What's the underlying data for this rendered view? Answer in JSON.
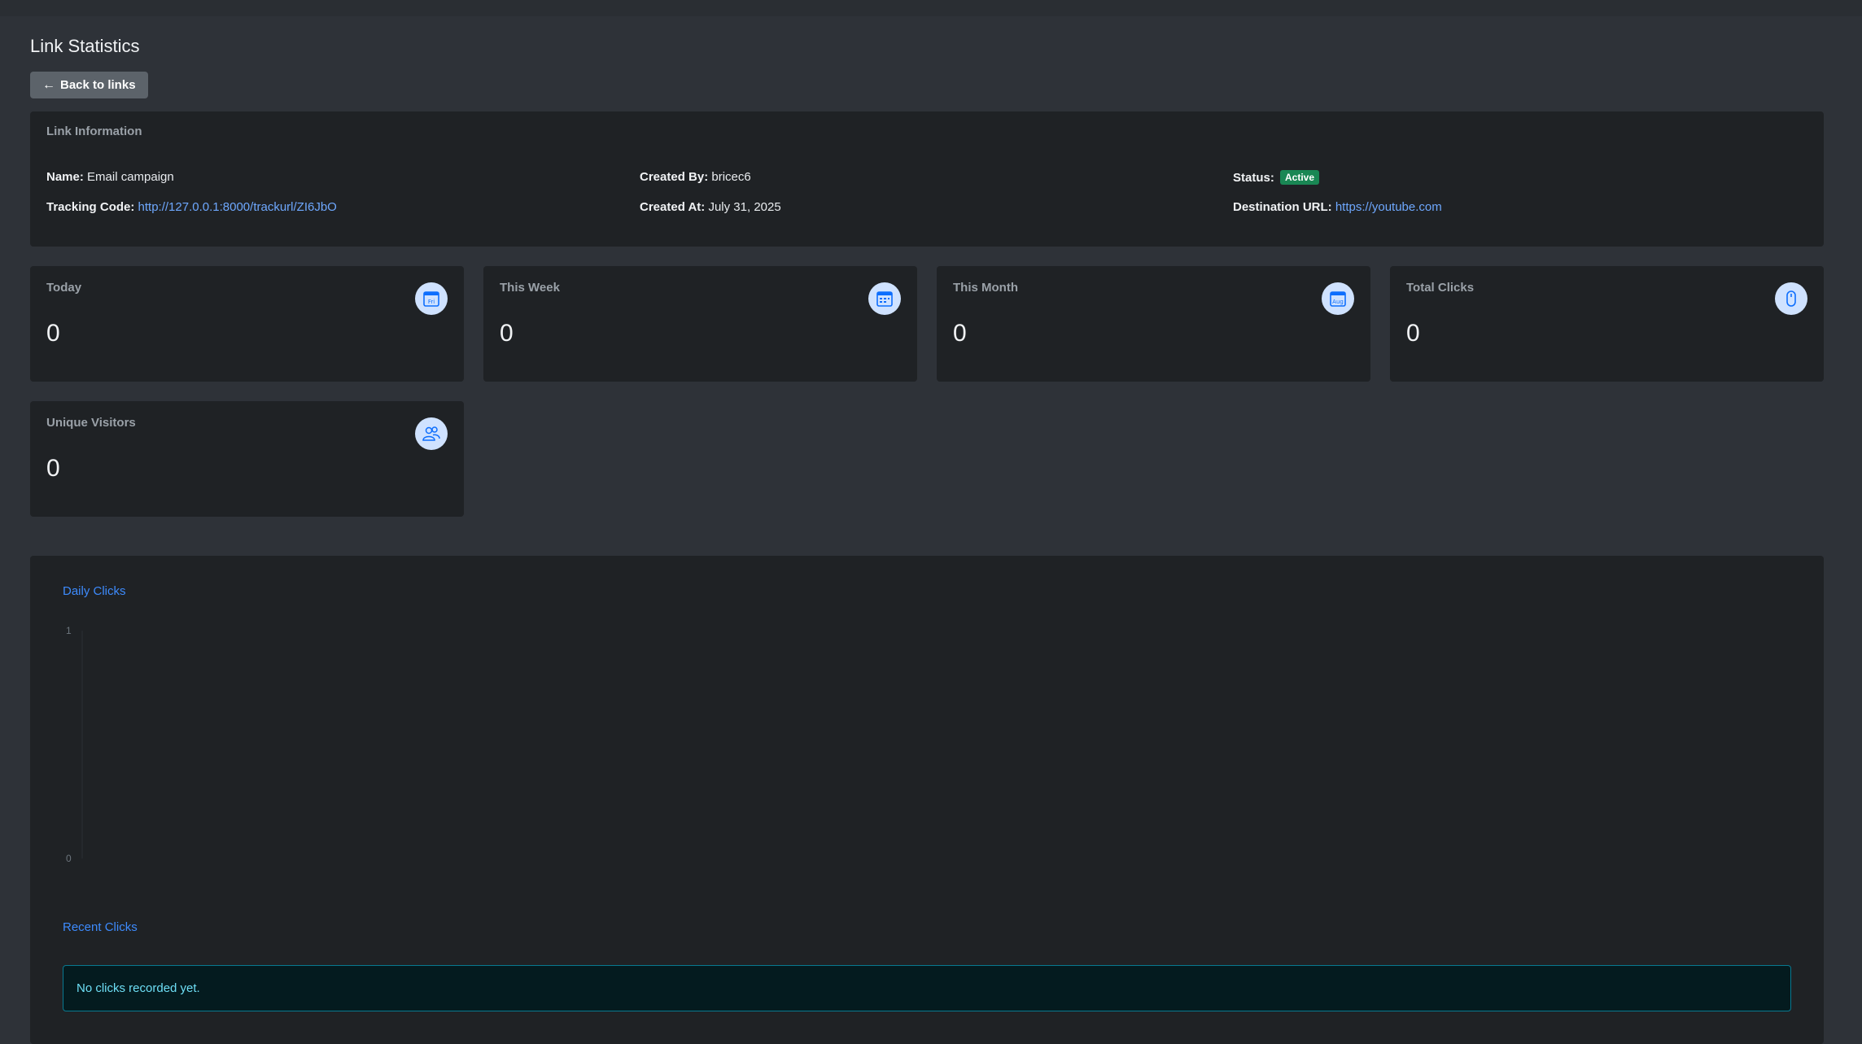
{
  "page": {
    "title": "Link Statistics",
    "back_label": "Back to links"
  },
  "info": {
    "header": "Link Information",
    "name_label": "Name:",
    "name_value": "Email campaign",
    "tracking_label": "Tracking Code:",
    "tracking_value": "http://127.0.0.1:8000/trackurl/ZI6JbO",
    "created_by_label": "Created By:",
    "created_by_value": "bricec6",
    "created_at_label": "Created At:",
    "created_at_value": "July 31, 2025",
    "status_label": "Status:",
    "status_value": "Active",
    "destination_label": "Destination URL:",
    "destination_value": "https://youtube.com"
  },
  "stats": [
    {
      "label": "Today",
      "value": "0",
      "icon": "calendar-day-icon",
      "icon_text": "Fri"
    },
    {
      "label": "This Week",
      "value": "0",
      "icon": "calendar-week-icon"
    },
    {
      "label": "This Month",
      "value": "0",
      "icon": "calendar-month-icon",
      "icon_text": "Aug"
    },
    {
      "label": "Total Clicks",
      "value": "0",
      "icon": "mouse-icon"
    },
    {
      "label": "Unique Visitors",
      "value": "0",
      "icon": "people-icon"
    }
  ],
  "chart": {
    "title": "Daily Clicks",
    "recent_title": "Recent Clicks",
    "empty_message": "No clicks recorded yet."
  },
  "chart_data": {
    "type": "line",
    "title": "Daily Clicks",
    "x": [],
    "series": [],
    "yticks": [
      "1",
      "0"
    ],
    "ylim": [
      0,
      1
    ],
    "xlabel": "",
    "ylabel": "",
    "grid": false
  },
  "colors": {
    "accent": "#3d8bfd",
    "link": "#6ea8fe",
    "status_active": "#198754",
    "icon_bg": "#cfe2ff",
    "icon_fg": "#0d6efd"
  }
}
